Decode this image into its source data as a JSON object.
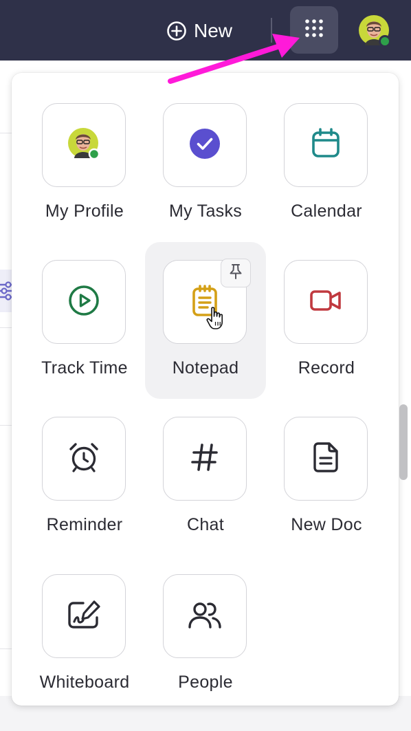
{
  "topbar": {
    "new_label": "New"
  },
  "apps": [
    {
      "label": "My Profile",
      "icon": "avatar-icon"
    },
    {
      "label": "My Tasks",
      "icon": "check-circle-icon",
      "color": "#5a4fcf"
    },
    {
      "label": "Calendar",
      "icon": "calendar-icon",
      "color": "#1f8a8a"
    },
    {
      "label": "Track Time",
      "icon": "play-circle-icon",
      "color": "#1f7a45"
    },
    {
      "label": "Notepad",
      "icon": "notepad-icon",
      "color": "#d4a017"
    },
    {
      "label": "Record",
      "icon": "video-camera-icon",
      "color": "#c0393f"
    },
    {
      "label": "Reminder",
      "icon": "alarm-clock-icon",
      "color": "#2b2b33"
    },
    {
      "label": "Chat",
      "icon": "hashtag-icon",
      "color": "#2b2b33"
    },
    {
      "label": "New Doc",
      "icon": "document-icon",
      "color": "#2b2b33"
    },
    {
      "label": "Whiteboard",
      "icon": "whiteboard-icon",
      "color": "#2b2b33"
    },
    {
      "label": "People",
      "icon": "people-icon",
      "color": "#2b2b33"
    }
  ],
  "colors": {
    "topbar_bg": "#2f3149",
    "annotation_arrow": "#ff1ad9",
    "online_status": "#2ea04a"
  }
}
